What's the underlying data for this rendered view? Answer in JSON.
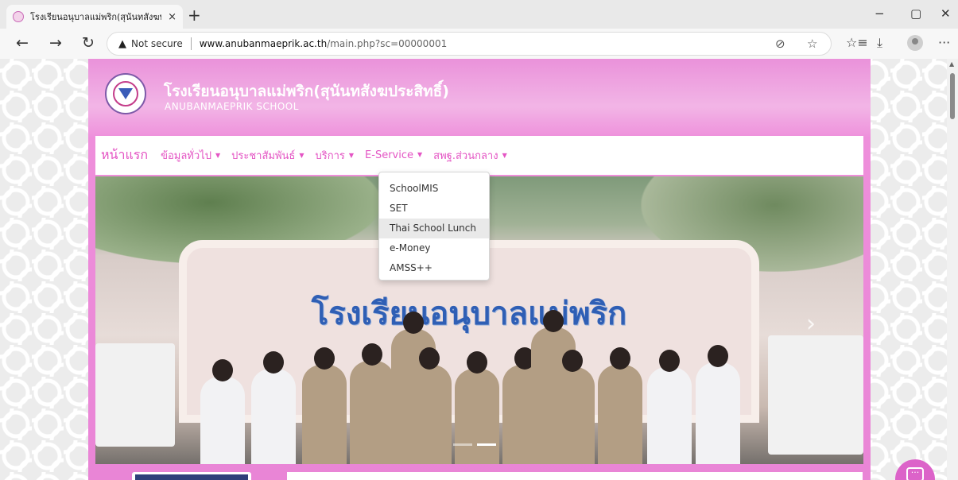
{
  "browser": {
    "tab_title": "โรงเรียนอนุบาลแม่พริก(สุนันทสังฆประสิ...",
    "new_tab": "+",
    "close_tab": "×",
    "window_controls": {
      "minimize": "−",
      "restore": "▢",
      "close": "✕"
    },
    "nav": {
      "back": "←",
      "forward": "→",
      "reload": "↻"
    },
    "warning_icon": "▲",
    "not_secure": "Not secure",
    "url_host": "www.anubanmaeprik.ac.th",
    "url_path": "/main.php?sc=00000001",
    "icons": {
      "tracking": "⊘",
      "favorite": "☆",
      "favorites_bar": "☆≡",
      "download": "⤓",
      "more": "···"
    }
  },
  "site": {
    "name_th": "โรงเรียนอนุบาลแม่พริก(สุนันทสังฆประสิทธิ์)",
    "name_en": "ANUBANMAEPRIK SCHOOL",
    "menu": {
      "home": "หน้าแรก",
      "items": [
        {
          "label": "ข้อมูลทั่วไป"
        },
        {
          "label": "ประชาสัมพันธ์"
        },
        {
          "label": "บริการ"
        },
        {
          "label": "E-Service"
        },
        {
          "label": "สพฐ.ส่วนกลาง"
        }
      ],
      "caret": "▼"
    },
    "dropdown": {
      "items": [
        {
          "label": "SchoolMIS"
        },
        {
          "label": "SET"
        },
        {
          "label": "Thai School Lunch"
        },
        {
          "label": "e-Money"
        },
        {
          "label": "AMSS++"
        }
      ],
      "hovered": "Thai School Lunch"
    },
    "slider": {
      "sign_text": "โรงเรียนอนุบาลแม่พริก",
      "next_arrow": "›",
      "slide_count": 2,
      "active_slide": 2
    },
    "chat_icon": "···"
  }
}
